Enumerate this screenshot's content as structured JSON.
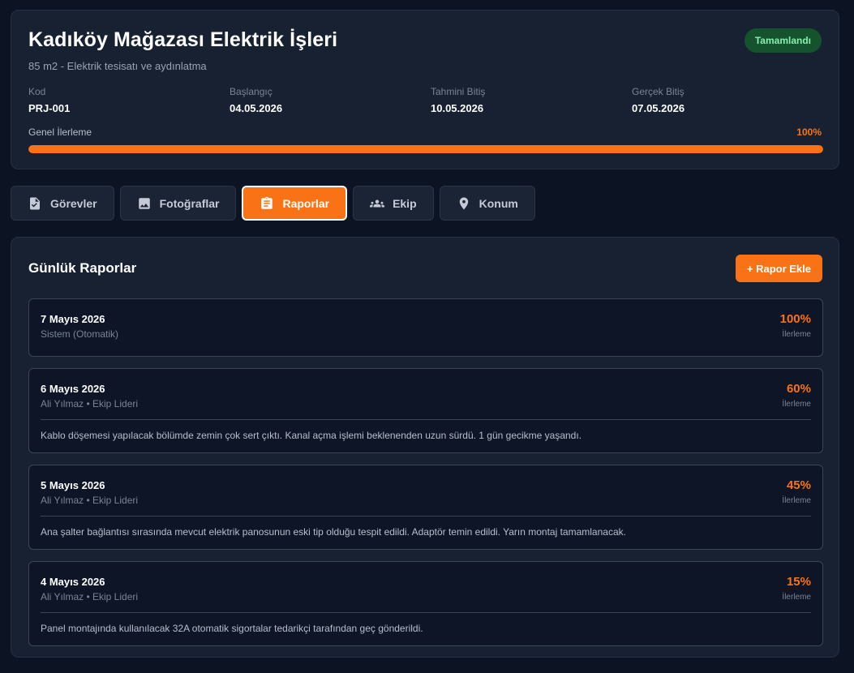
{
  "project": {
    "title": "Kadıköy Mağazası Elektrik İşleri",
    "subtitle": "85 m2 - Elektrik tesisatı ve aydınlatma",
    "status": "Tamamlandı",
    "meta": [
      {
        "label": "Kod",
        "value": "PRJ-001"
      },
      {
        "label": "Başlangıç",
        "value": "04.05.2026"
      },
      {
        "label": "Tahmini Bitiş",
        "value": "10.05.2026"
      },
      {
        "label": "Gerçek Bitiş",
        "value": "07.05.2026"
      }
    ],
    "progress_label": "Genel İlerleme",
    "progress_text": "100%",
    "progress_value": 100
  },
  "tabs": [
    {
      "label": "Görevler",
      "icon": "task-check-icon"
    },
    {
      "label": "Fotoğraflar",
      "icon": "image-icon"
    },
    {
      "label": "Raporlar",
      "icon": "clipboard-icon",
      "active": true
    },
    {
      "label": "Ekip",
      "icon": "group-icon"
    },
    {
      "label": "Konum",
      "icon": "location-pin-icon"
    }
  ],
  "reports": {
    "title": "Günlük Raporlar",
    "add_label": "+ Rapor Ekle",
    "progress_caption": "İlerleme",
    "items": [
      {
        "date": "7 Mayıs 2026",
        "author": "Sistem (Otomatik)",
        "progress": "100%",
        "text": ""
      },
      {
        "date": "6 Mayıs 2026",
        "author": "Ali Yılmaz • Ekip Lideri",
        "progress": "60%",
        "text": "Kablo döşemesi yapılacak bölümde zemin çok sert çıktı. Kanal açma işlemi beklenenden uzun sürdü. 1 gün gecikme yaşandı."
      },
      {
        "date": "5 Mayıs 2026",
        "author": "Ali Yılmaz • Ekip Lideri",
        "progress": "45%",
        "text": "Ana şalter bağlantısı sırasında mevcut elektrik panosunun eski tip olduğu tespit edildi. Adaptör temin edildi. Yarın montaj tamamlanacak."
      },
      {
        "date": "4 Mayıs 2026",
        "author": "Ali Yılmaz • Ekip Lideri",
        "progress": "15%",
        "text": "Panel montajında kullanılacak 32A otomatik sigortalar tedarikçi tarafından geç gönderildi."
      }
    ]
  },
  "colors": {
    "accent": "#f97316",
    "background": "#0c1322",
    "card": "#172131",
    "status_bg": "#14532d",
    "status_text": "#86efac"
  }
}
